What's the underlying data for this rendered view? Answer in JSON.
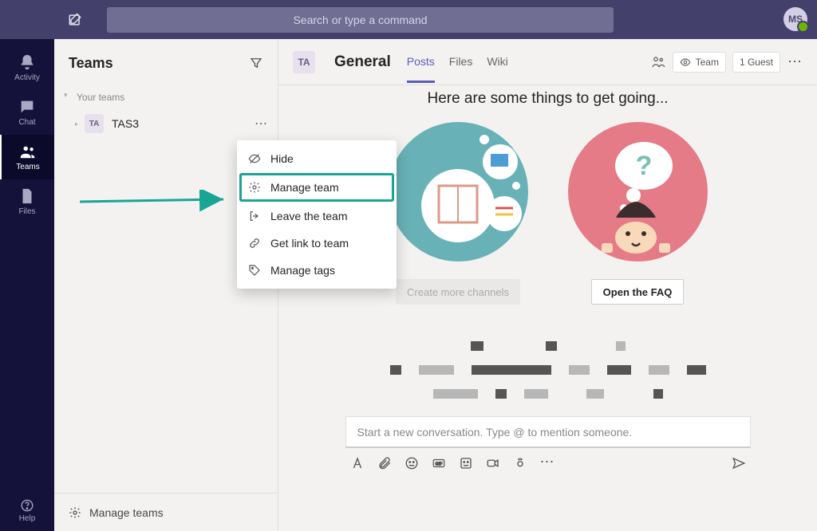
{
  "topbar": {
    "search_placeholder": "Search or type a command",
    "avatar_initials": "MS"
  },
  "rail": {
    "items": [
      {
        "label": "Activity"
      },
      {
        "label": "Chat"
      },
      {
        "label": "Teams"
      },
      {
        "label": "Files"
      }
    ],
    "help_label": "Help"
  },
  "panel": {
    "title": "Teams",
    "section_label": "Your teams",
    "team": {
      "initials": "TA",
      "name": "TAS3"
    },
    "footer_label": "Manage teams"
  },
  "context_menu": {
    "items": [
      {
        "label": "Hide"
      },
      {
        "label": "Manage team"
      },
      {
        "label": "Leave the team"
      },
      {
        "label": "Get link to team"
      },
      {
        "label": "Manage tags"
      }
    ]
  },
  "header": {
    "team_initials": "TA",
    "channel": "General",
    "tabs": [
      {
        "label": "Posts",
        "active": true
      },
      {
        "label": "Files",
        "active": false
      },
      {
        "label": "Wiki",
        "active": false
      }
    ],
    "privacy_label": "Team",
    "guest_label": "1 Guest"
  },
  "content": {
    "intro": "Here are some things to get going...",
    "card1_button": "Create more channels",
    "card2_button": "Open the FAQ"
  },
  "composer": {
    "placeholder": "Start a new conversation. Type @ to mention someone."
  }
}
